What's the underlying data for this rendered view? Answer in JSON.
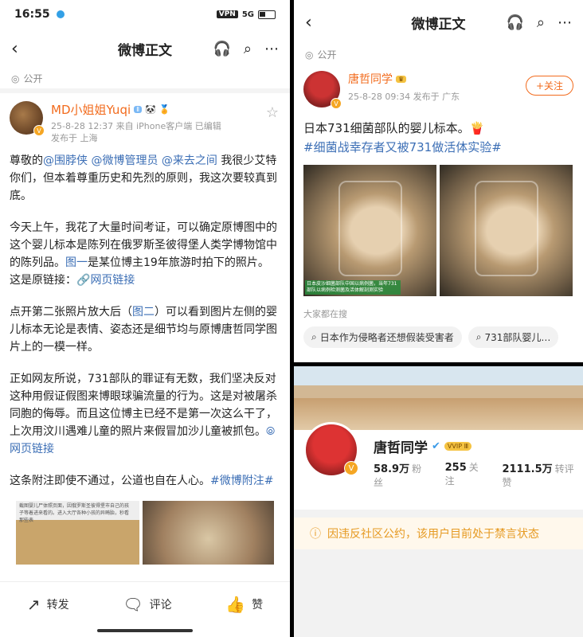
{
  "left": {
    "status_time": "16:55",
    "status_vpn": "VPN",
    "status_net": "5G",
    "nav_title": "微博正文",
    "public": "公开",
    "author": {
      "name": "MD小姐姐Yuqi",
      "meta_line1": "25-8-28 12:37  来自 iPhone客户端  已编辑",
      "meta_line2": "发布于 上海"
    },
    "paragraphs": {
      "p1_a": "尊敬的",
      "p1_mentions": "@围脖侠 @微博管理员 @来去之间",
      "p1_b": " 我很少艾特你们，但本着尊重历史和先烈的原则，我这次要较真到底。",
      "p2_a": "今天上午，我花了大量时间考证，可以确定原博图中的这个婴儿标本是陈列在俄罗斯圣彼得堡人类学博物馆中的陈列品。",
      "p2_link": "图一",
      "p2_b": "是某位博主19年旅游时拍下的照片。",
      "p2_c": "这是原链接：",
      "p2_weblink": "网页链接",
      "p3_a": "点开第二张照片放大后（",
      "p3_link": "图二",
      "p3_b": "）可以看到图片左侧的婴儿标本无论是表情、姿态还是细节均与原博唐哲同学图片上的一模一样。",
      "p4_a": "正如网友所说，731部队的罪证有无数，我们坚决反对这种用假证假图来博眼球骗流量的行为。这是对被屠杀同胞的侮辱。而且这位博主已经不是第一次这么干了，上次用汶川遇难儿童的照片来假冒加沙儿童被抓包。",
      "p4_weblink": "网页链接",
      "p5_a": "这条附注即使不通过，公道也自在人心。",
      "p5_tag": "#微博附注#"
    },
    "thumb_caption": "截图婴儿尸体照页面，因俄罗斯圣彼得堡市自己的孩子等着进来看的。进入大厅各种小孩的异畸胎，秒看那些表",
    "actions": {
      "repost": "转发",
      "comment": "评论",
      "like": "赞"
    }
  },
  "right_top": {
    "nav_title": "微博正文",
    "public": "公开",
    "author": {
      "name": "唐哲同学",
      "meta": "25-8-28 09:34  发布于 广东"
    },
    "follow": "+关注",
    "text": "日本731细菌部队的婴儿标本。",
    "tag": "#细菌战幸存者又被731做活体实验#",
    "img_caption": "日本皮沙细菌部队中国以病例菌，当年731部队以病例检测菌及活体解剖测实验",
    "section": "大家都在搜",
    "chips": [
      "日本作为侵略者还想假装受害者",
      "731部队婴儿…"
    ]
  },
  "right_bottom": {
    "name": "唐哲同学",
    "vvip": "VVIP Ⅲ",
    "fans_num": "58.9万",
    "fans_label": "粉丝",
    "follow_num": "255",
    "follow_label": "关注",
    "reposts_num": "2111.5万",
    "reposts_label": "转评赞",
    "banned": "因违反社区公约，该用户目前处于禁言状态"
  }
}
